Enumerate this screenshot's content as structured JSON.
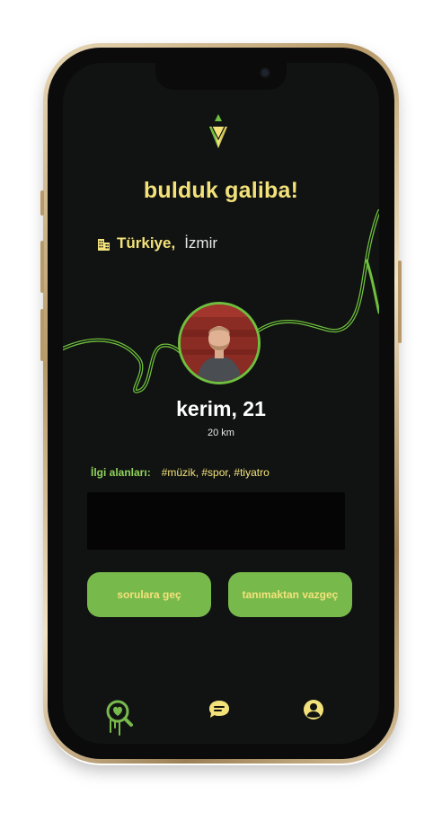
{
  "header": {
    "title": "bulduk galiba!"
  },
  "location": {
    "country": "Türkiye,",
    "city": "İzmir",
    "icon": "building-icon"
  },
  "profile": {
    "name_age": "kerim, 21",
    "distance": "20 km"
  },
  "interests": {
    "label": "İlgi alanları:",
    "value": "#müzik, #spor, #tiyatro"
  },
  "actions": {
    "left_label": "sorulara geç",
    "right_label": "tanımaktan vazgeç"
  },
  "bottom_nav": {
    "items": [
      "heart-search-icon",
      "chat-icon",
      "profile-icon"
    ]
  },
  "colors": {
    "accent_yellow": "#f3e27a",
    "accent_green": "#78b94c",
    "background": "#111312"
  }
}
